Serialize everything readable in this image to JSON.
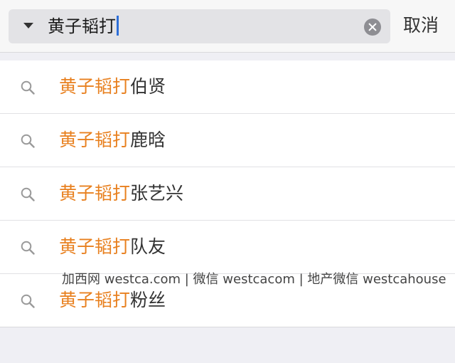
{
  "search": {
    "query": "黄子韬打",
    "cancel_label": "取消"
  },
  "suggestions": [
    {
      "prefix": "黄子韬打",
      "rest": "伯贤"
    },
    {
      "prefix": "黄子韬打",
      "rest": "鹿晗"
    },
    {
      "prefix": "黄子韬打",
      "rest": "张艺兴"
    },
    {
      "prefix": "黄子韬打",
      "rest": "队友"
    },
    {
      "prefix": "黄子韬打",
      "rest": "粉丝"
    }
  ],
  "watermark": "加西网 westca.com | 微信 westcacom | 地产微信 westcahouse",
  "colors": {
    "highlight": "#e8801f",
    "text": "#333333",
    "cursor": "#2e6fd8"
  },
  "icons": {
    "dropdown": "caret-down-icon",
    "clear": "clear-icon",
    "suggestion": "search-icon"
  }
}
